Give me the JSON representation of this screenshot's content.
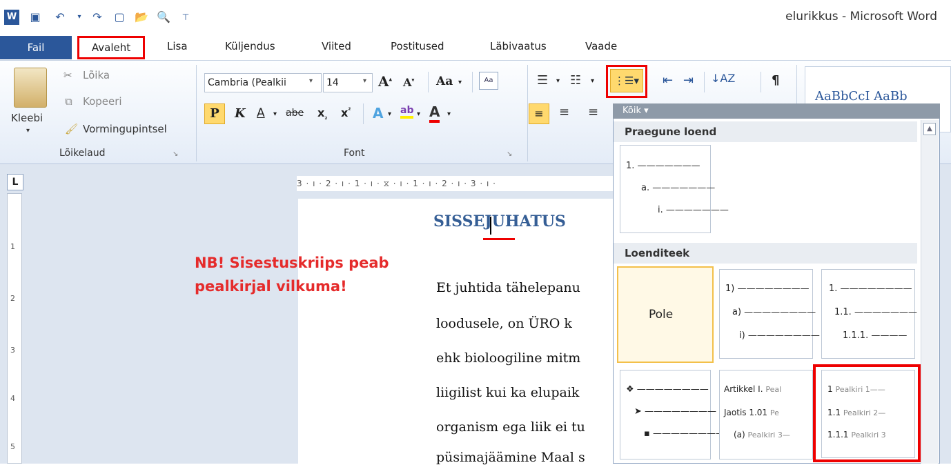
{
  "window": {
    "title": "elurikkus - Microsoft Word"
  },
  "tabs": {
    "file": "Fail",
    "home": "Avaleht",
    "insert": "Lisa",
    "layout": "Küljendus",
    "refs": "Viited",
    "mail": "Postitused",
    "review": "Läbivaatus",
    "view": "Vaade"
  },
  "clipboard": {
    "paste": "Kleebi",
    "cut": "Lõika",
    "copy": "Kopeeri",
    "painter": "Vormingupintsel",
    "label": "Lõikelaud"
  },
  "font": {
    "name": "Cambria (Pealkii",
    "size": "14",
    "label": "Font",
    "aa": "Aa"
  },
  "styles": {
    "preview": "AaBbCcI  AaBb"
  },
  "ruler": {
    "corner": "L",
    "ticks": "3 · ı · 2 · ı · 1 · ı · ⧖ · ı · 1 · ı · 2 · ı · 3 · ı ·"
  },
  "document": {
    "heading": "SISSEJUHATUS",
    "lines": [
      "Et juhtida tähelepanu",
      "loodusele, on ÜRO k",
      "ehk bioloogiline mitm",
      "liigilist kui ka elupaik",
      "organism ega liik ei tu",
      "püsimajäämine Maal s"
    ],
    "note": "NB! Sisestuskriips peab pealkirjal vilkuma!"
  },
  "multilevel": {
    "header": "Kõik ▾",
    "current_section": "Praegune loend",
    "library_section": "Loenditeek",
    "current": [
      "1. ———————",
      "a. ———————",
      "i. ———————"
    ],
    "none": "Pole",
    "lib1": [
      "1) ————————",
      "a) ————————",
      "i) ————————"
    ],
    "lib2": [
      "1. ————————",
      "1.1. ———————",
      "1.1.1. ————"
    ],
    "lib3": [
      "❖ ————————",
      "➤ ————————",
      "▪ ————————"
    ],
    "lib4_a": "Artikkel I.",
    "lib4_a2": "Peal",
    "lib4_b": "Jaotis 1.01",
    "lib4_b2": "Pe",
    "lib4_c": "(a)",
    "lib4_c2": "Pealkiri 3—",
    "lib5_a": "1",
    "lib5_a2": "Pealkiri 1——",
    "lib5_b": "1.1",
    "lib5_b2": "Pealkiri 2—",
    "lib5_c": "1.1.1",
    "lib5_c2": "Pealkiri 3"
  },
  "colors": {
    "accent": "#2b579a",
    "highlight": "#e00000",
    "note": "#e52b2b"
  }
}
